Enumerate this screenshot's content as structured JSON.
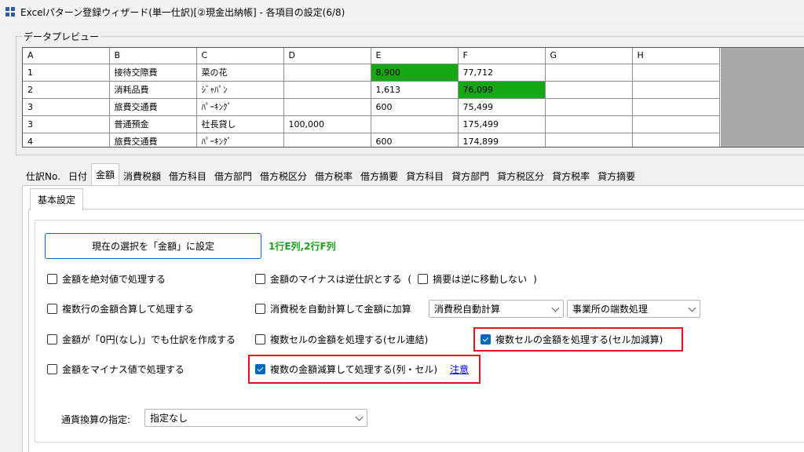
{
  "window": {
    "title": "Excelパターン登録ウィザード(単一仕訳)[②現金出納帳] - 各項目の設定(6/8)"
  },
  "preview": {
    "group_title": "データプレビュー",
    "columns": [
      "A",
      "B",
      "C",
      "D",
      "E",
      "F",
      "G",
      "H"
    ],
    "rows": [
      [
        "1",
        "接待交際費",
        "菜の花",
        "",
        "8,900",
        "77,712",
        "",
        ""
      ],
      [
        "2",
        "消耗品費",
        "ｼﾞｬﾊﾟﾝ",
        "",
        "1,613",
        "76,099",
        "",
        ""
      ],
      [
        "3",
        "旅費交通費",
        "ﾊﾟｰｷﾝｸﾞ",
        "",
        "600",
        "75,499",
        "",
        ""
      ],
      [
        "3",
        "普通預金",
        "社長貸し",
        "100,000",
        "",
        "175,499",
        "",
        ""
      ],
      [
        "4",
        "旅費交通費",
        "ﾊﾟｰｷﾝｸﾞ",
        "",
        "600",
        "174,899",
        "",
        ""
      ]
    ],
    "highlight_color": "#16a716"
  },
  "tabs": {
    "items": [
      "仕訳No.",
      "日付",
      "金額",
      "消費税額",
      "借方科目",
      "借方部門",
      "借方税区分",
      "借方税率",
      "借方摘要",
      "貸方科目",
      "貸方部門",
      "貸方税区分",
      "貸方税率",
      "貸方摘要"
    ],
    "active": "金額"
  },
  "inner_tab": {
    "label": "基本設定"
  },
  "settings": {
    "set_button": "現在の選択を「金額」に設定",
    "selection_info": "1行E列,2行F列",
    "absolute": {
      "label": "金額を絶対値で処理する",
      "checked": false
    },
    "negative_reverse": {
      "label": "金額のマイナスは逆仕訳とする",
      "checked": false
    },
    "paren_open": "(",
    "paren_close": ")",
    "no_move_summary": {
      "label": "摘要は逆に移動しない",
      "checked": false
    },
    "multi_row_sum": {
      "label": "複数行の金額合算して処理する",
      "checked": false
    },
    "auto_tax": {
      "label": "消費税を自動計算して金額に加算",
      "checked": false
    },
    "tax_calc_select": "消費税自動計算",
    "rounding_select": "事業所の端数処理",
    "zero_yen": {
      "label": "金額が「0円(なし)」でも仕訳を作成する",
      "checked": false
    },
    "multi_cell_concat": {
      "label": "複数セルの金額を処理する(セル連結)",
      "checked": false
    },
    "multi_cell_addsub": {
      "label": "複数セルの金額を処理する(セル加減算)",
      "checked": true
    },
    "negative_value": {
      "label": "金額をマイナス値で処理する",
      "checked": false
    },
    "multi_subtract": {
      "label": "複数の金額減算して処理する(列・セル)",
      "checked": true
    },
    "note_link": "注意",
    "currency_label": "通貨換算の指定:",
    "currency_select": "指定なし"
  },
  "colors": {
    "accent": "#0067c0",
    "annotation_red": "#e0141e",
    "info_green": "#1aa31a"
  }
}
